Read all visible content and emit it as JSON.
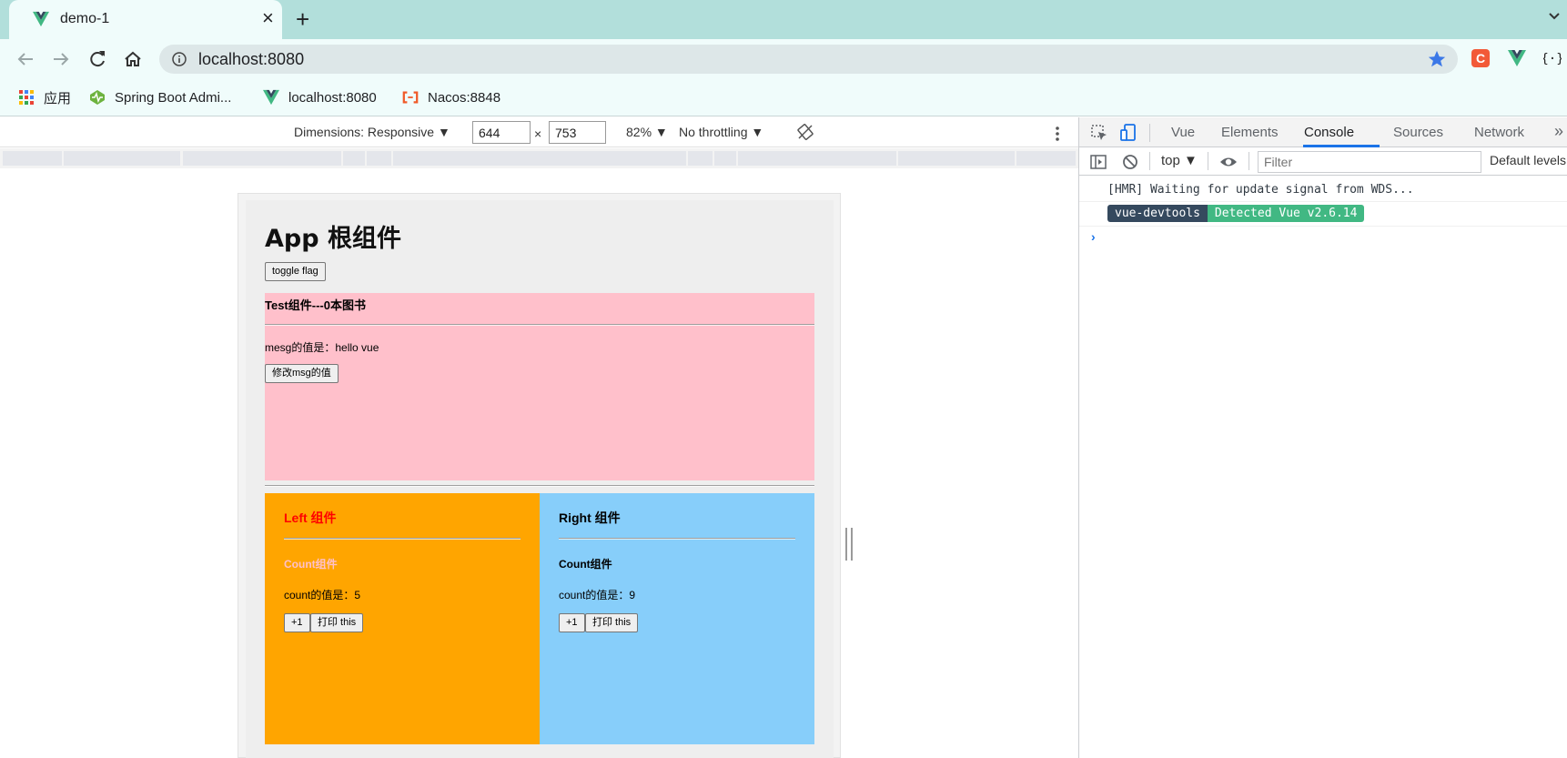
{
  "browser": {
    "tab_title": "demo-1",
    "url": "localhost:8080",
    "bookmarks": [
      {
        "label": "应用",
        "icon": "apps-grid-icon"
      },
      {
        "label": "Spring Boot Admi...",
        "icon": "spring-boot-admin-icon"
      },
      {
        "label": "localhost:8080",
        "icon": "vue-logo-icon"
      },
      {
        "label": "Nacos:8848",
        "icon": "nacos-icon"
      }
    ]
  },
  "device_toolbar": {
    "dimensions_label": "Dimensions: Responsive ▼",
    "width": "644",
    "times": "×",
    "height": "753",
    "zoom": "82% ▼",
    "throttling": "No throttling ▼"
  },
  "app": {
    "title": "App 根组件",
    "toggle_button": "toggle flag",
    "test": {
      "title": "Test组件---0本图书",
      "msg_text": "mesg的值是：hello vue",
      "modify_button": "修改msg的值"
    },
    "left": {
      "title": "Left 组件",
      "count_title": "Count组件",
      "count_text": "count的值是：5",
      "plus_button": "+1",
      "print_button": "打印 this",
      "bg_color": "#ffa500",
      "title_color": "#ff0000"
    },
    "right": {
      "title": "Right 组件",
      "count_title": "Count组件",
      "count_text": "count的值是：9",
      "plus_button": "+1",
      "print_button": "打印 this",
      "bg_color": "#87cefa"
    }
  },
  "devtools": {
    "tabs": [
      "Vue",
      "Elements",
      "Console",
      "Sources",
      "Network"
    ],
    "active_tab": "Console",
    "more_tabs": "»",
    "context": "top ▼",
    "filter_placeholder": "Filter",
    "levels": "Default levels",
    "console": {
      "hmr_line": "[HMR] Waiting for update signal from WDS...",
      "badge_left": "vue-devtools",
      "badge_right": "Detected Vue v2.6.14"
    }
  }
}
